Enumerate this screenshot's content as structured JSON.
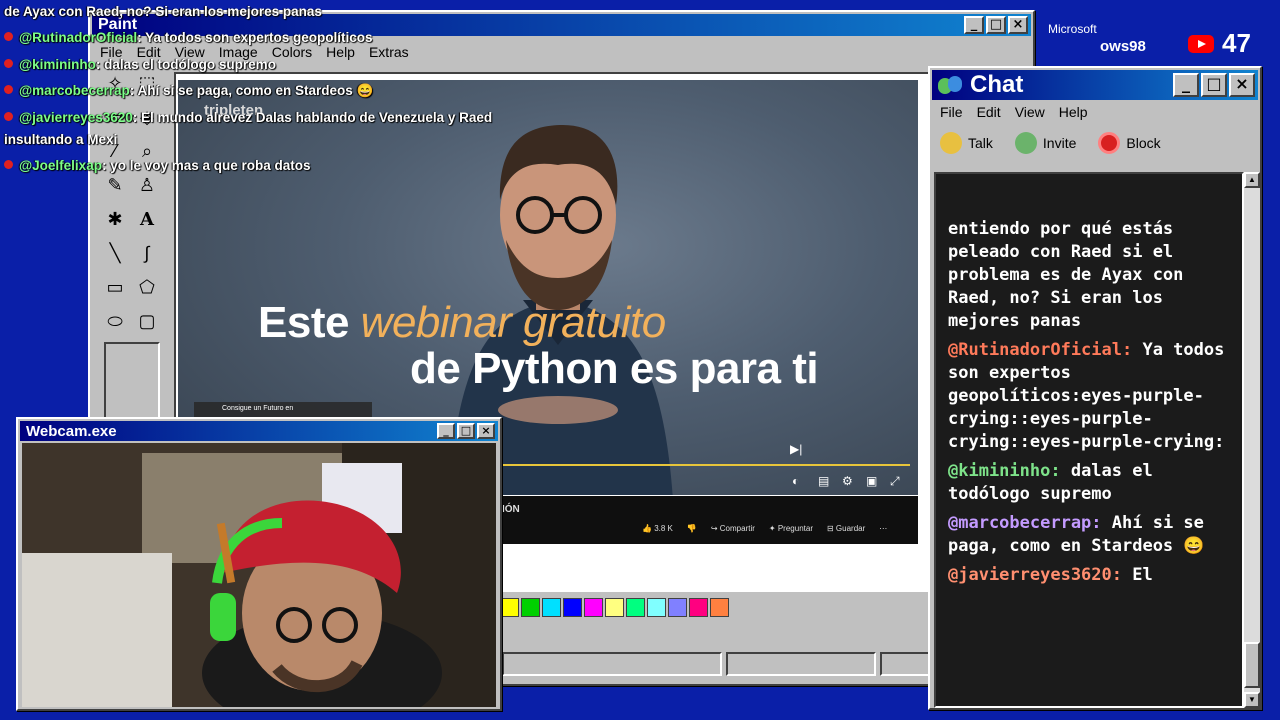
{
  "overlay_chat": {
    "lines": [
      {
        "user": "",
        "text": "de Ayax con Raed, no? Si eran los mejores panas"
      },
      {
        "user": "@RutinadorOficial",
        "text": ": Ya todos son expertos geopolíticos"
      },
      {
        "user": "@kimininho",
        "text": ": dalas el todólogo supremo"
      },
      {
        "user": "@marcobecerrap",
        "text": ": Ahí si se paga, como en Stardeos 😄"
      },
      {
        "user": "@javierreyes3620",
        "text": ": El mundo alrevez Dalas hablando de Venezuela y Raed"
      },
      {
        "user": "",
        "text": "insultando a Mexi"
      },
      {
        "user": "@Joelfelixap",
        "text": ": yo le voy mas a que roba datos"
      }
    ]
  },
  "paint": {
    "title": "Paint",
    "menu": [
      "File",
      "Edit",
      "View",
      "Image",
      "Colors",
      "Help",
      "Extras"
    ],
    "palette": [
      "#ffff00",
      "#00d000",
      "#00e0ff",
      "#0000ff",
      "#ff00ff",
      "#ffff80",
      "#00ff80",
      "#80ffff",
      "#8080ff",
      "#ff0080",
      "#ff8040"
    ]
  },
  "video": {
    "overlay_text": "tripleten",
    "title_part1": "Este ",
    "title_accent": "webinar gratuito",
    "title_line2": "de Python es para ti",
    "chip": "Consigue un Futuro en",
    "below_label": "IÓN",
    "actions": [
      "3.8 K",
      "Compartir",
      "Preguntar",
      "Guardar"
    ]
  },
  "corner": {
    "brand_small": "Microsoft",
    "brand_os": "ows98",
    "viewer_count": "47"
  },
  "chat": {
    "title": "Chat",
    "menu": [
      "File",
      "Edit",
      "View",
      "Help"
    ],
    "toolbar": [
      "Talk",
      "Invite",
      "Block"
    ],
    "messages": [
      {
        "user": "",
        "text": "entiendo por qué estás peleado con Raed si el problema es de Ayax con Raed, no? Si eran los mejores panas",
        "color": "cu-red"
      },
      {
        "user": "@RutinadorOficial:",
        "text": " Ya todos son expertos geopolíticos:eyes-purple-crying::eyes-purple-crying::eyes-purple-crying:",
        "color": "cu-red"
      },
      {
        "user": "@kimininho:",
        "text": " dalas el todólogo supremo",
        "color": "cu-green"
      },
      {
        "user": "@marcobecerrap:",
        "text": " Ahí si se paga, como en Stardeos 😄",
        "color": "cu-purple"
      },
      {
        "user": "@javierreyes3620:",
        "text": " El",
        "color": "cu-orange"
      }
    ]
  },
  "webcam": {
    "title": "Webcam.exe"
  }
}
